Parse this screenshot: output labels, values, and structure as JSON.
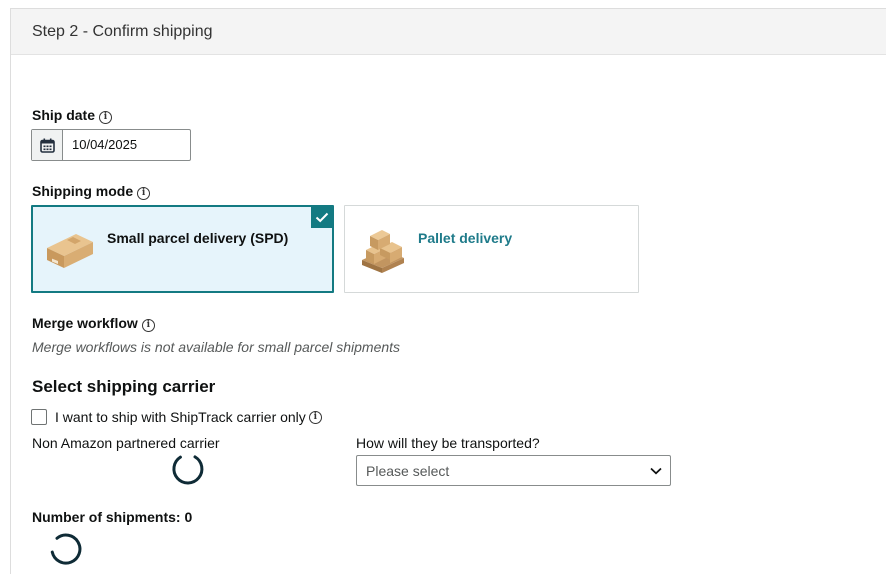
{
  "header": {
    "title": "Step 2 - Confirm shipping"
  },
  "ship_date": {
    "label": "Ship date",
    "info_icon": "info-icon",
    "calendar_icon": "calendar-icon",
    "value": "10/04/2025"
  },
  "shipping_mode": {
    "label": "Shipping mode",
    "options": [
      {
        "label": "Small parcel delivery (SPD)",
        "icon": "parcel-box-icon",
        "selected": true
      },
      {
        "label": "Pallet delivery",
        "icon": "pallet-icon",
        "selected": false
      }
    ],
    "accent": "#137a82"
  },
  "merge_workflow": {
    "label": "Merge workflow",
    "note": "Merge workflows is not available for small parcel shipments"
  },
  "carrier": {
    "title": "Select shipping carrier",
    "checkbox_label": "I want to ship with ShipTrack carrier only",
    "checkbox_checked": false,
    "non_partnered_label": "Non Amazon partnered carrier",
    "transport_label": "How will they be transported?",
    "transport_select": {
      "placeholder": "Please select"
    }
  },
  "shipments": {
    "label": "Number of shipments: 0"
  }
}
